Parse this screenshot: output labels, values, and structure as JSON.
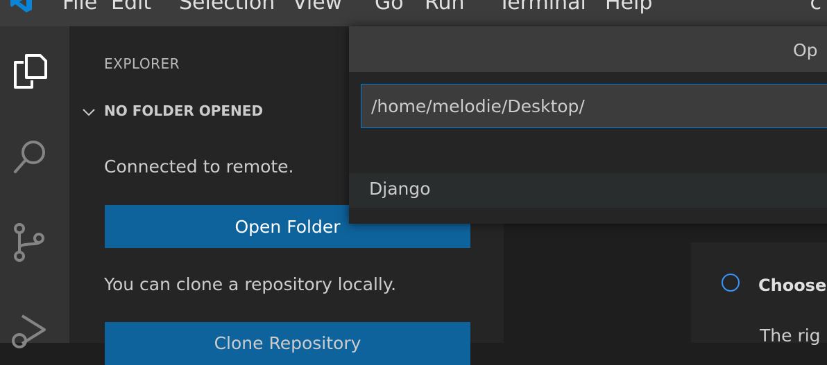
{
  "menubar": {
    "items": [
      "File",
      "Edit",
      "Selection",
      "View",
      "Go",
      "Run",
      "Terminal",
      "Help"
    ],
    "right_glyph": "c"
  },
  "activity_bar": {
    "icons": [
      "explorer-icon",
      "search-icon",
      "source-control-icon",
      "run-debug-icon"
    ]
  },
  "sidebar": {
    "title": "EXPLORER",
    "section_label": "NO FOLDER OPENED",
    "connected_text": "Connected to remote.",
    "open_folder_label": "Open Folder",
    "clone_text": "You can clone a repository locally.",
    "clone_button_label": "Clone Repository"
  },
  "quick_open": {
    "title": "Op",
    "input_value": "/home/melodie/Desktop/",
    "items": [
      {
        "label": ".."
      },
      {
        "label": "Django"
      }
    ]
  },
  "welcome": {
    "choose_label": "Choose",
    "sub_text": "The rig"
  },
  "colors": {
    "accent": "#0e639c",
    "focus_border": "#007fd4",
    "radio": "#3794ff"
  }
}
